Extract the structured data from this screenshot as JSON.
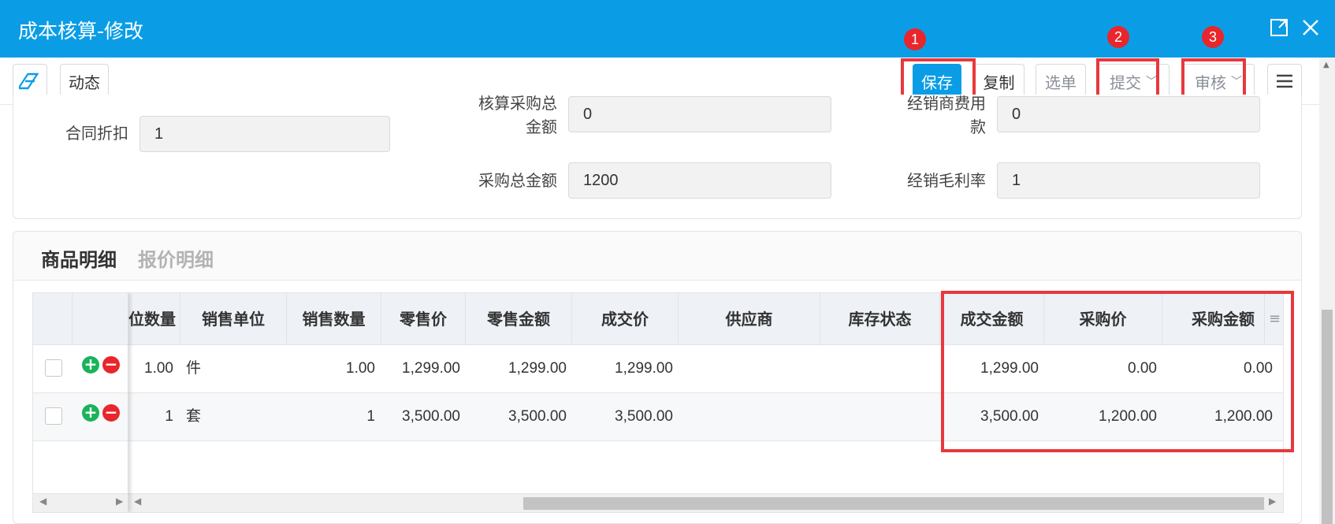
{
  "window": {
    "title": "成本核算-修改"
  },
  "toolbar": {
    "dynamic_label": "动态",
    "save_label": "保存",
    "copy_label": "复制",
    "select_label": "选单",
    "submit_label": "提交",
    "audit_label": "审核"
  },
  "markers": [
    "1",
    "2",
    "3"
  ],
  "form": {
    "contract_discount": {
      "label": "合同折扣",
      "value": "1"
    },
    "acct_purchase_total": {
      "label_line1": "核算采购总",
      "label_line2": "金额",
      "value": "0"
    },
    "dealer_fee": {
      "label_line1": "经销商费用",
      "label_line2": "款",
      "value": "0"
    },
    "purchase_total": {
      "label": "采购总金额",
      "value": "1200"
    },
    "dealer_margin": {
      "label": "经销毛利率",
      "value": "1"
    }
  },
  "detail": {
    "tabs": [
      "商品明细",
      "报价明细"
    ],
    "columns": [
      "位数量",
      "销售单位",
      "销售数量",
      "零售价",
      "零售金额",
      "成交价",
      "供应商",
      "库存状态",
      "成交金额",
      "采购价",
      "采购金额"
    ],
    "rows": [
      [
        "1.00",
        "件",
        "1.00",
        "1,299.00",
        "1,299.00",
        "1,299.00",
        "",
        "",
        "1,299.00",
        "0.00",
        "0.00"
      ],
      [
        "1",
        "套",
        "1",
        "3,500.00",
        "3,500.00",
        "3,500.00",
        "",
        "",
        "3,500.00",
        "1,200.00",
        "1,200.00"
      ]
    ]
  },
  "colors": {
    "brand": "#0a9de6",
    "annotation": "#e8383d",
    "add": "#1ab35a",
    "remove": "#e8262c"
  },
  "icons": [
    "eraser-icon",
    "maximize-icon",
    "close-icon",
    "menu-icon",
    "add-row-icon",
    "remove-row-icon"
  ]
}
